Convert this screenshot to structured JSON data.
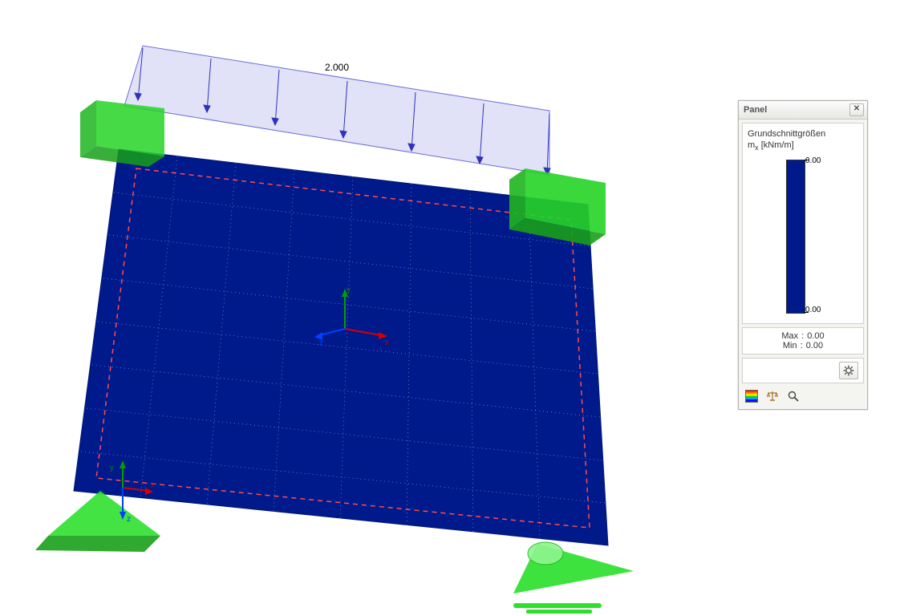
{
  "viewport": {
    "load_label": "2.000",
    "axis_labels": {
      "x": "x",
      "y": "y",
      "z": "z"
    },
    "axis_labels_small": {
      "x": "x",
      "y": "y",
      "z": "z"
    }
  },
  "panel": {
    "title": "Panel",
    "headline_line1": "Grundschnittgrößen",
    "headline_symbol": "m",
    "headline_sub": "x",
    "headline_unit": " [kNm/m]",
    "legend_top": "0.00",
    "legend_bottom": "0.00",
    "max_label": "Max",
    "max_value": "0.00",
    "min_label": "Min",
    "min_value": "0.00",
    "sep": ":"
  },
  "icons": {
    "settings": "settings",
    "gradient": "color-scale",
    "scale": "scale",
    "magnifier": "magnifier"
  }
}
